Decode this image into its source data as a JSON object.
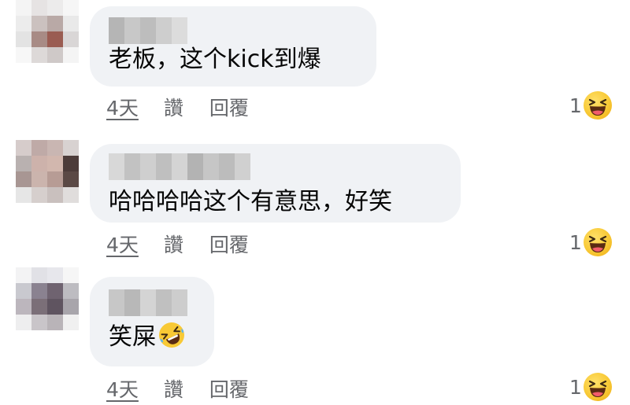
{
  "comments": [
    {
      "text": "老板，这个kick到爆",
      "time": "4天",
      "like_label": "讚",
      "reply_label": "回覆",
      "reaction_count": "1",
      "reaction_icon": "laughing-reaction-icon"
    },
    {
      "text": "哈哈哈哈这个有意思，好笑",
      "time": "4天",
      "like_label": "讚",
      "reply_label": "回覆",
      "reaction_count": "1",
      "reaction_icon": "laughing-reaction-icon"
    },
    {
      "text": "笑屎",
      "text_emoji": "rolling-on-floor-laughing-emoji",
      "time": "4天",
      "like_label": "讚",
      "reply_label": "回覆",
      "reaction_count": "1",
      "reaction_icon": "laughing-reaction-icon"
    }
  ],
  "colors": {
    "bubble": "#f0f2f5",
    "comment_text": "#050505",
    "meta_text": "#65676b",
    "reaction": "#f7c531"
  }
}
